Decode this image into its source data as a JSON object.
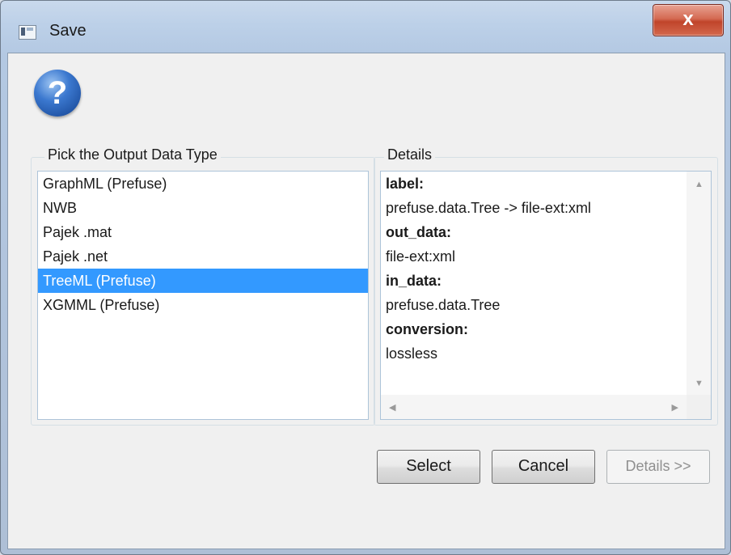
{
  "window": {
    "title": "Save",
    "close_label": "x"
  },
  "help_icon": {
    "glyph": "?",
    "name": "help-question-icon",
    "color": "#2a63b8"
  },
  "output_group": {
    "title": "Pick the Output Data Type",
    "items": [
      {
        "label": "GraphML (Prefuse)",
        "selected": false
      },
      {
        "label": "NWB",
        "selected": false
      },
      {
        "label": "Pajek .mat",
        "selected": false
      },
      {
        "label": "Pajek .net",
        "selected": false
      },
      {
        "label": "TreeML (Prefuse)",
        "selected": true
      },
      {
        "label": "XGMML (Prefuse)",
        "selected": false
      }
    ]
  },
  "details_group": {
    "title": "Details",
    "lines": [
      {
        "text": "label:",
        "bold": true
      },
      {
        "text": "prefuse.data.Tree -> file-ext:xml",
        "bold": false
      },
      {
        "text": "out_data:",
        "bold": true
      },
      {
        "text": "file-ext:xml",
        "bold": false
      },
      {
        "text": "in_data:",
        "bold": true
      },
      {
        "text": "prefuse.data.Tree",
        "bold": false
      },
      {
        "text": "conversion:",
        "bold": true
      },
      {
        "text": "lossless",
        "bold": false
      }
    ]
  },
  "buttons": {
    "select": "Select",
    "cancel": "Cancel",
    "details": "Details >>"
  },
  "colors": {
    "selection": "#3399ff",
    "close_button": "#c7442b",
    "window_frame": "#bcd0e8"
  }
}
